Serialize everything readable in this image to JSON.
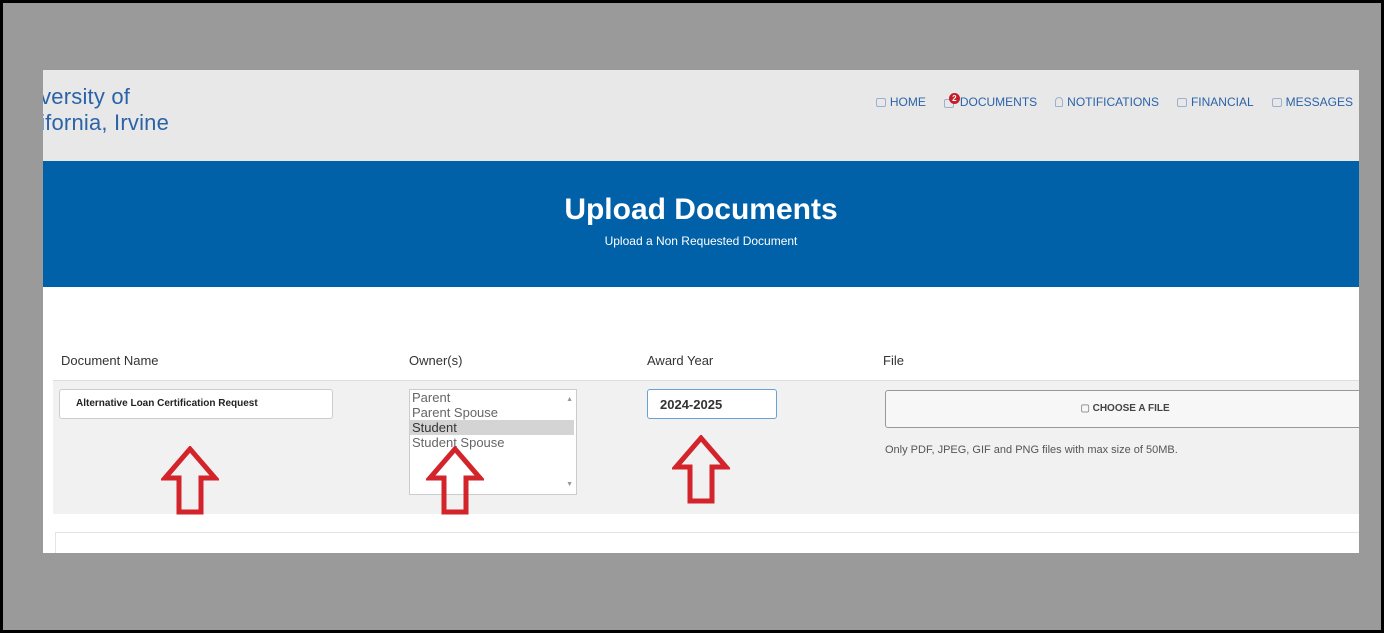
{
  "header": {
    "logo_line1": "iversity of",
    "logo_line2": "lifornia, Irvine",
    "nav": [
      {
        "label": "HOME",
        "icon": "home-icon"
      },
      {
        "label": "DOCUMENTS",
        "icon": "documents-icon",
        "badge": "2"
      },
      {
        "label": "NOTIFICATIONS",
        "icon": "bell-icon"
      },
      {
        "label": "FINANCIAL",
        "icon": "card-icon"
      },
      {
        "label": "MESSAGES",
        "icon": "mail-icon"
      }
    ]
  },
  "hero": {
    "title": "Upload Documents",
    "subtitle": "Upload a Non Requested Document"
  },
  "form": {
    "headers": {
      "document_name": "Document Name",
      "owners": "Owner(s)",
      "award_year": "Award Year",
      "file": "File"
    },
    "document_name_value": "Alternative Loan Certification Request",
    "owner_options": [
      "Parent",
      "Parent Spouse",
      "Student",
      "Student Spouse"
    ],
    "owner_selected": "Student",
    "award_year_value": "2024-2025",
    "choose_file_label": "CHOOSE A FILE",
    "file_note": "Only PDF, JPEG, GIF and PNG files with max size of 50MB."
  },
  "colors": {
    "brand_blue": "#0060a8",
    "annotation_red": "#d3242b"
  }
}
